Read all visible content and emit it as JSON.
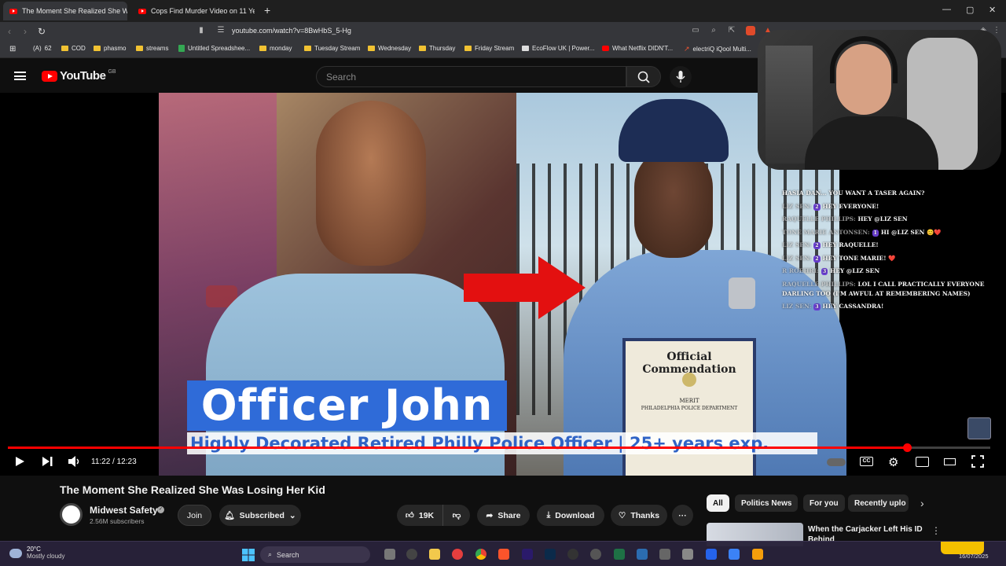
{
  "browser": {
    "tabs": [
      {
        "label": "The Moment She Realized She W",
        "active": true
      },
      {
        "label": "Cops Find Murder Video on 11 Year",
        "active": false
      }
    ],
    "new_tab": "+",
    "url": "youtube.com/watch?v=8BwHbS_5-Hg",
    "bookmarks": [
      {
        "label": "62",
        "prefix": "(A)"
      },
      {
        "label": "COD"
      },
      {
        "label": "phasmo"
      },
      {
        "label": "streams"
      },
      {
        "label": "Untitled Spreadshee..."
      },
      {
        "label": "monday"
      },
      {
        "label": "Tuesday Stream"
      },
      {
        "label": "Wednesday"
      },
      {
        "label": "Thursday"
      },
      {
        "label": "Friday Stream"
      },
      {
        "label": "EcoFlow UK | Power..."
      },
      {
        "label": "What Netflix DIDN'T..."
      },
      {
        "label": "electriQ iQool Multi..."
      }
    ]
  },
  "youtube": {
    "logo_text": "YouTube",
    "logo_country": "GB",
    "search_placeholder": "Search"
  },
  "video": {
    "name_banner": "Officer John",
    "caption_banner": "Highly Decorated Retired Philly Police Officer | 25+ years exp.",
    "certificate_title": "Official Commendation",
    "certificate_merit": "MERIT",
    "certificate_dept": "PHILADELPHIA POLICE DEPARTMENT",
    "time_display": "11:22 / 12:23",
    "progress_fraction": 0.915
  },
  "chat": [
    {
      "name": "",
      "badge": "",
      "msg": "HASIA DAN... YOU WANT A TASER AGAIN?"
    },
    {
      "name": "LIZ SEN:",
      "badge": "2",
      "msg": "HEY EVERYONE!"
    },
    {
      "name": "RAQUELLE PHILLIPS:",
      "badge": "",
      "msg": "HEY @LIZ SEN"
    },
    {
      "name": "TONE MARIE ANTONSEN:",
      "badge": "1",
      "msg": "HI @LIZ SEN 😊❤️"
    },
    {
      "name": "LIZ SEN:",
      "badge": "2",
      "msg": "HEY RAQUELLE!"
    },
    {
      "name": "LIZ SEN:",
      "badge": "2",
      "msg": "HEY TONE MARIE! ❤️"
    },
    {
      "name": "R ROEHRI:",
      "badge": "3",
      "msg": "HEY @LIZ SEN"
    },
    {
      "name": "RAQUELLE PHILLIPS:",
      "badge": "",
      "msg": "LOL I CALL PRACTICALLY EVERYONE DARLING TOO (I'M AWFUL AT REMEMBERING NAMES)"
    },
    {
      "name": "LIZ SEN:",
      "badge": "3",
      "msg": "HEY CASSANDRA!"
    }
  ],
  "watch": {
    "title": "The Moment She Realized She Was Losing Her Kid",
    "channel": "Midwest Safety",
    "subscribers": "2.56M subscribers",
    "join": "Join",
    "subscribed": "Subscribed",
    "likes": "19K",
    "share": "Share",
    "download": "Download",
    "thanks": "Thanks"
  },
  "chips": [
    "All",
    "Politics News",
    "For you",
    "Recently uplo"
  ],
  "recommendation": {
    "title": "When the Carjacker Left His ID Behind"
  },
  "taskbar": {
    "temp": "20°C",
    "weather": "Mostly cloudy",
    "search": "Search",
    "date": "16/07/2025"
  },
  "colors": {
    "youtube_red": "#ff0000",
    "name_banner_bg": "#2f6bd8",
    "caption_text": "#2f63c6",
    "chat_badge": "#6b3fd4"
  }
}
